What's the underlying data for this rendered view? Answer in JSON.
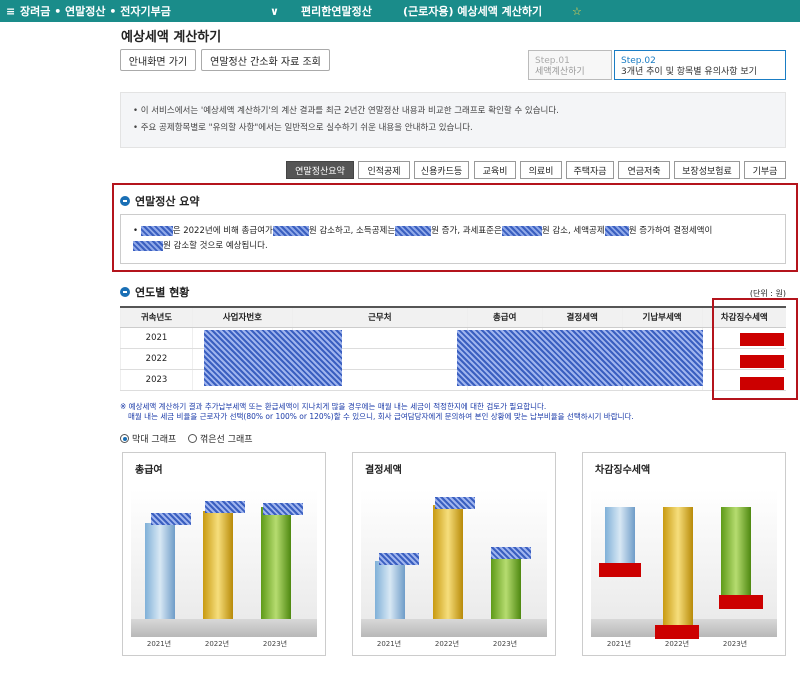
{
  "topbar": {
    "menu_icon": "≡",
    "section": "장려금 • 연말정산 • 전자기부금",
    "dropdown": "∨",
    "sub": "편리한연말정산",
    "current": "(근로자용) 예상세액 계산하기",
    "star": "☆"
  },
  "page_title": "예상세액 계산하기",
  "buttons": {
    "guide": "안내화면 가기",
    "simplified": "연말정산 간소화 자료 조회"
  },
  "steps": [
    {
      "num": "Step.01",
      "label": "세액계산하기"
    },
    {
      "num": "Step.02",
      "label": "3개년 추이 및 항목별 유의사항 보기"
    }
  ],
  "info": [
    "• 이 서비스에서는 '예상세액 계산하기'의 계산 결과를 최근 2년간 연말정산 내용과 비교한 그래프로 확인할 수 있습니다.",
    "• 주요 공제항목별로 \"유의할 사항\"에서는 일반적으로 실수하기 쉬운 내용을 안내하고 있습니다."
  ],
  "tabs": [
    "연말정산요약",
    "인적공제",
    "신용카드등",
    "교육비",
    "의료비",
    "주택자금",
    "연금저축",
    "보장성보험료",
    "기부금"
  ],
  "summary": {
    "title": "연말정산 요약",
    "s1": "은 2022년에 비해 총급여가",
    "s2": "원 감소하고, 소득공제는",
    "s3": "원 증가, 과세표준은",
    "s4": "원 감소, 세액공제",
    "s5": "원 증가하여 결정세액이",
    "s6": "원 감소할 것으로 예상됩니다."
  },
  "yearly": {
    "title": "연도별 현황",
    "unit": "(단위 : 원)",
    "headers": [
      "귀속년도",
      "사업자번호",
      "근무처",
      "총급여",
      "결정세액",
      "기납부세액",
      "차감징수세액"
    ],
    "rows": [
      "2021",
      "2022",
      "2023"
    ]
  },
  "notes": [
    "※ 예상세액 계산하기 결과 추가납부세액 또는 환급세액이 지나치게 많을 경우에는 매월 내는 세금이 적정한지에 대한 검토가 필요합니다.",
    "매월 내는 세금 비율을 근로자가 선택(80% or 100% or 120%)할 수 있으니, 회사 급여담당자에게 문의하여 본인 상황에 맞는 납부비율을 선택하시기 바랍니다."
  ],
  "graph_type": {
    "bar": "막대 그래프",
    "line": "꺾은선 그래프"
  },
  "panels": [
    {
      "title": "총급여"
    },
    {
      "title": "결정세액"
    },
    {
      "title": "차감징수세액"
    }
  ],
  "x_years": [
    "2021년",
    "2022년",
    "2023년"
  ],
  "colors": {
    "accent": "#1a8c8a",
    "highlight": "#b4141c",
    "bar2021": "#7fb0d8",
    "bar2022": "#e0b838",
    "bar2023": "#7ab830"
  }
}
